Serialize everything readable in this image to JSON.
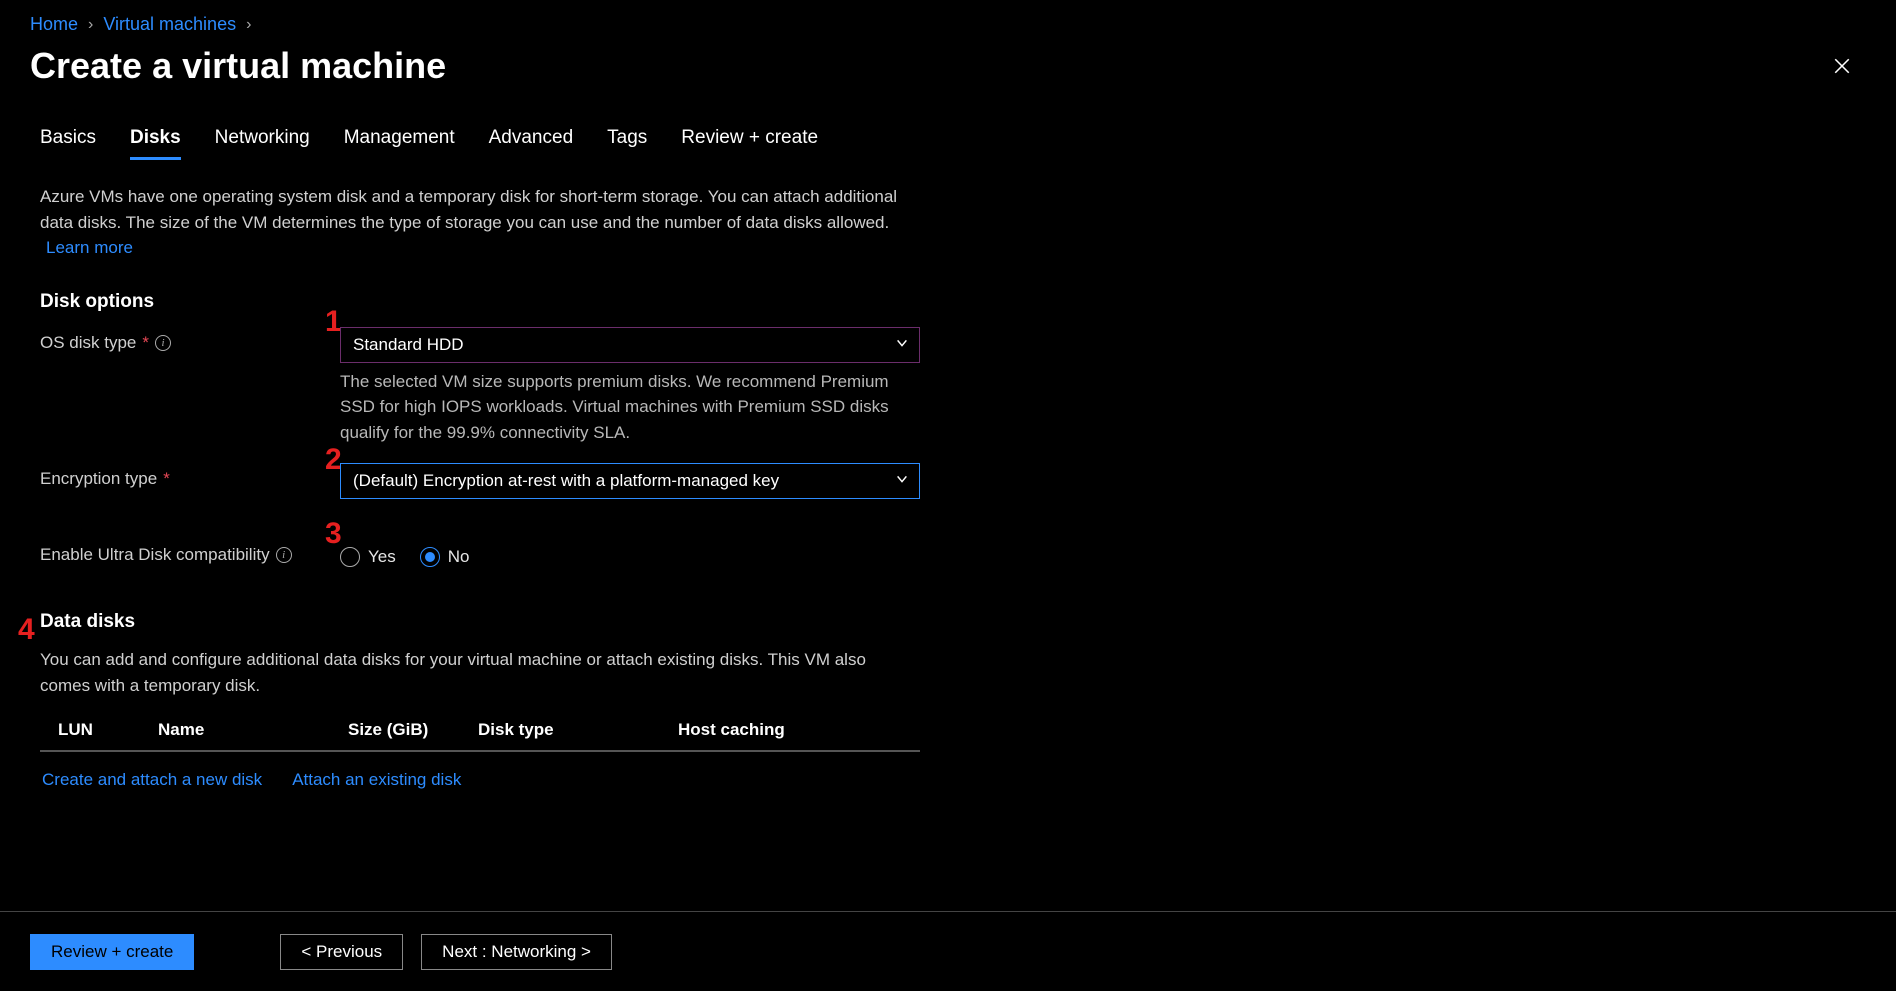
{
  "breadcrumb": {
    "home": "Home",
    "vm": "Virtual machines"
  },
  "title": "Create a virtual machine",
  "tabs": {
    "basics": "Basics",
    "disks": "Disks",
    "networking": "Networking",
    "management": "Management",
    "advanced": "Advanced",
    "tags": "Tags",
    "review": "Review + create"
  },
  "intro": {
    "text": "Azure VMs have one operating system disk and a temporary disk for short-term storage. You can attach additional data disks. The size of the VM determines the type of storage you can use and the number of data disks allowed.",
    "learn_more": "Learn more"
  },
  "disk_options": {
    "heading": "Disk options",
    "os_disk_type_label": "OS disk type",
    "os_disk_type_value": "Standard HDD",
    "os_disk_help": "The selected VM size supports premium disks. We recommend Premium SSD for high IOPS workloads. Virtual machines with Premium SSD disks qualify for the 99.9% connectivity SLA.",
    "encryption_label": "Encryption type",
    "encryption_value": "(Default) Encryption at-rest with a platform-managed key",
    "ultra_label": "Enable Ultra Disk compatibility",
    "ultra_yes": "Yes",
    "ultra_no": "No"
  },
  "data_disks": {
    "heading": "Data disks",
    "desc": "You can add and configure additional data disks for your virtual machine or attach existing disks. This VM also comes with a temporary disk.",
    "cols": {
      "lun": "LUN",
      "name": "Name",
      "size": "Size (GiB)",
      "type": "Disk type",
      "cache": "Host caching"
    },
    "create_link": "Create and attach a new disk",
    "attach_link": "Attach an existing disk"
  },
  "footer": {
    "review": "Review + create",
    "previous": "< Previous",
    "next": "Next : Networking >"
  },
  "annotations": {
    "a1": "1",
    "a2": "2",
    "a3": "3",
    "a4": "4"
  }
}
